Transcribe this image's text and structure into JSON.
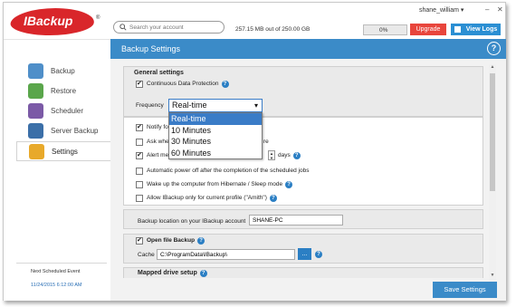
{
  "app": {
    "logo_text": "IBackup",
    "logo_reg": "®"
  },
  "search": {
    "placeholder": "Search your account"
  },
  "user": {
    "name": "shane_william ▾"
  },
  "window_controls": {
    "minimize": "–",
    "close": "✕"
  },
  "storage": {
    "text": "257.15 MB out of 250.00 GB",
    "percent_label": "0%",
    "percent_value": 0
  },
  "header_buttons": {
    "upgrade": "Upgrade",
    "view_logs": "View Logs"
  },
  "sidebar": {
    "items": [
      {
        "label": "Backup",
        "icon": "cloud-upload-icon",
        "color": "#4f8fc9"
      },
      {
        "label": "Restore",
        "icon": "cloud-download-icon",
        "color": "#5aa64b"
      },
      {
        "label": "Scheduler",
        "icon": "calendar-icon",
        "color": "#7b5aa6"
      },
      {
        "label": "Server Backup",
        "icon": "server-icon",
        "color": "#3b6fa8"
      },
      {
        "label": "Settings",
        "icon": "gear-icon",
        "color": "#e8a92a"
      }
    ],
    "next_scheduled_label": "Next Scheduled Event",
    "next_scheduled_value": "11/24/2015 6:12:00 AM"
  },
  "content": {
    "title": "Backup Settings",
    "help": "?",
    "general_settings": {
      "title": "General settings",
      "cdp_label": "Continuous Data Protection",
      "frequency_label": "Frequency",
      "frequency_value": "Real-time",
      "frequency_options": [
        "Real-time",
        "10 Minutes",
        "30 Minutes",
        "60 Minutes"
      ],
      "notify_label": "Notify fo",
      "ask_label": "Ask whe",
      "ask_tail": "re",
      "alert_label": "Alert me",
      "days_label": "days",
      "power_off_label": "Automatic power off after the completion of the scheduled jobs",
      "wake_label": "Wake up the computer from Hibernate / Sleep mode",
      "allow_label": "Allow IBackup only for current profile (\"Amith\")"
    },
    "backup_location": {
      "label": "Backup location on your IBackup account",
      "value": "SHANE-PC"
    },
    "open_file": {
      "label": "Open file Backup",
      "cache_label": "Cache",
      "cache_value": "C:\\ProgramData\\IBackup\\",
      "browse": "..."
    },
    "mapped_drive": {
      "title": "Mapped drive setup"
    },
    "save_button": "Save Settings"
  },
  "colors": {
    "accent": "#3b8bc8",
    "brand_red": "#d9262a",
    "upgrade": "#e8453c"
  }
}
